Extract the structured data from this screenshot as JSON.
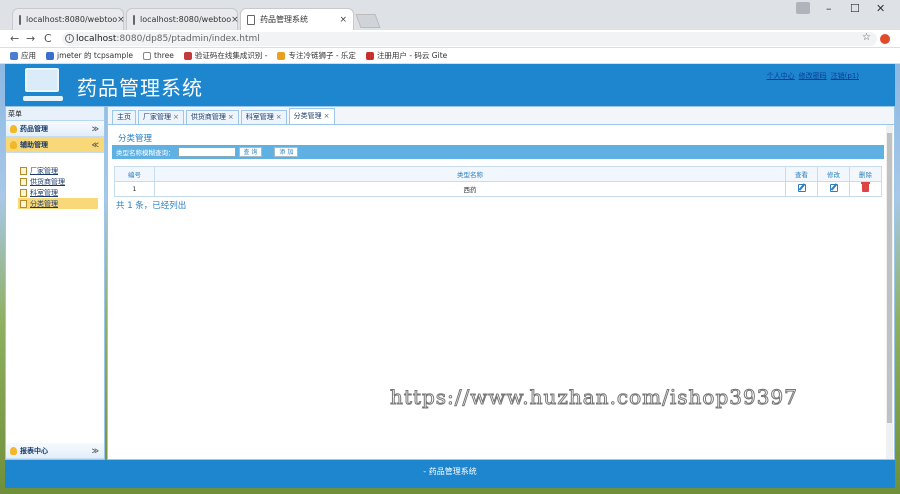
{
  "browser": {
    "tabs": [
      {
        "label": "localhost:8080/webtoo"
      },
      {
        "label": "localhost:8080/webtoo"
      },
      {
        "label": "药品管理系统"
      }
    ],
    "url_host": "localhost",
    "url_path": ":8080/dp85/ptadmin/index.html",
    "bookmarks": [
      {
        "label": "应用",
        "color": "#4a7fd0"
      },
      {
        "label": "jmeter 的 tcpsample",
        "color": "#3a6fd0"
      },
      {
        "label": "three",
        "color": "#888888"
      },
      {
        "label": "验证码在线集成识别 -",
        "color": "#c23a3a"
      },
      {
        "label": "专注冷链狮子 - 乐定",
        "color": "#e8a020"
      },
      {
        "label": "注册用户 - 码云 Gite",
        "color": "#c9302c"
      }
    ]
  },
  "app": {
    "title": "药品管理系统",
    "user_links": [
      "个人中心",
      "修改密码",
      "注销(p1)"
    ]
  },
  "sidebar": {
    "title": "菜单",
    "groups": [
      {
        "label": "药品管理"
      },
      {
        "label": "辅助管理"
      }
    ],
    "items": [
      {
        "label": "厂家管理"
      },
      {
        "label": "供货商管理"
      },
      {
        "label": "科室管理"
      },
      {
        "label": "分类管理"
      }
    ],
    "bottom_group": {
      "label": "报表中心"
    }
  },
  "main": {
    "tabs": [
      {
        "label": "主页",
        "closable": false
      },
      {
        "label": "厂家管理",
        "closable": true
      },
      {
        "label": "供货商管理",
        "closable": true
      },
      {
        "label": "科室管理",
        "closable": true
      },
      {
        "label": "分类管理",
        "closable": true
      }
    ],
    "section_title": "分类管理",
    "search": {
      "label": "类型名称模糊查询：",
      "value": "",
      "search_btn": "查 询",
      "add_btn": "添 加"
    },
    "table": {
      "headers": [
        "编号",
        "类型名称",
        "查看",
        "修改",
        "删除"
      ],
      "rows": [
        {
          "id": "1",
          "name": "西药"
        }
      ]
    },
    "summary": "共 1 条，已经列出"
  },
  "watermark": "https://www.huzhan.com/ishop39397",
  "footer": "- 药品管理系统"
}
